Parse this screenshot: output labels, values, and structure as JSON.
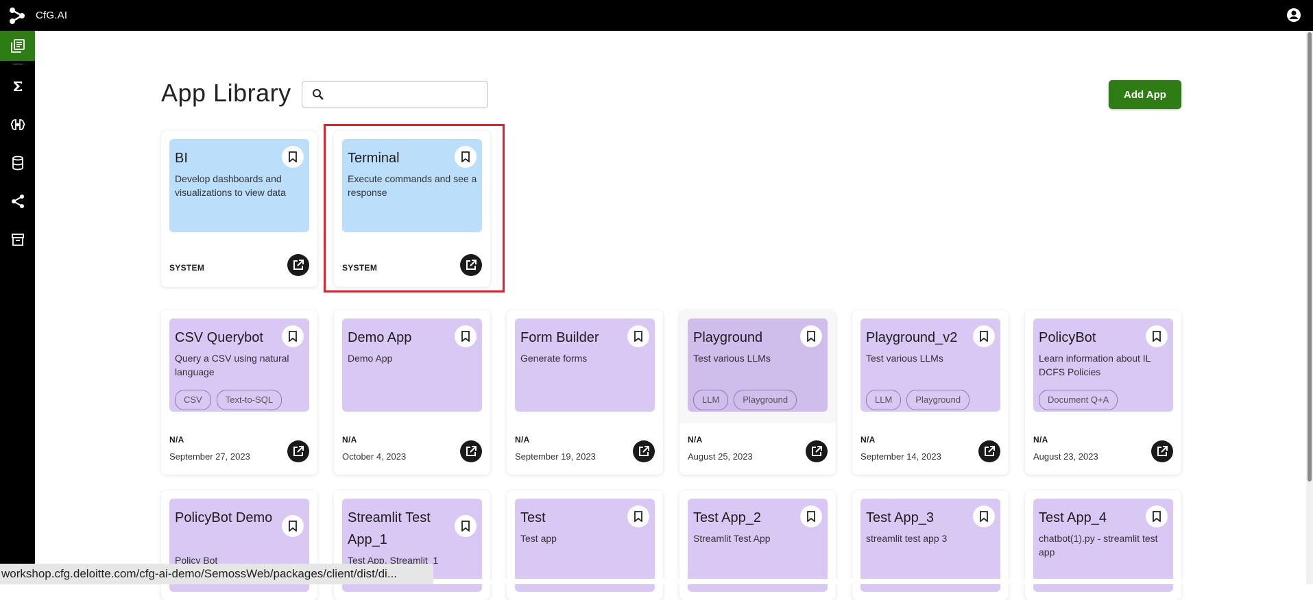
{
  "app": {
    "brand": "CfG.AI"
  },
  "page": {
    "title": "App Library",
    "search_placeholder": "",
    "add_button": "Add App"
  },
  "system_apps": [
    {
      "name": "BI",
      "description": "Develop dashboards and visualizations to view data",
      "owner": "SYSTEM"
    },
    {
      "name": "Terminal",
      "description": "Execute commands and see a response",
      "owner": "SYSTEM"
    }
  ],
  "apps_row1": [
    {
      "name": "CSV Querybot",
      "description": "Query a CSV using natural language",
      "tags": [
        "CSV",
        "Text-to-SQL"
      ],
      "owner": "N/A",
      "date": "September 27, 2023"
    },
    {
      "name": "Demo App",
      "description": "Demo App",
      "tags": [],
      "owner": "N/A",
      "date": "October 4, 2023"
    },
    {
      "name": "Form Builder",
      "description": "Generate forms",
      "tags": [],
      "owner": "N/A",
      "date": "September 19, 2023"
    },
    {
      "name": "Playground",
      "description": "Test various LLMs",
      "tags": [
        "LLM",
        "Playground"
      ],
      "owner": "N/A",
      "date": "August 25, 2023"
    },
    {
      "name": "Playground_v2",
      "description": "Test various LLMs",
      "tags": [
        "LLM",
        "Playground"
      ],
      "owner": "N/A",
      "date": "September 14, 2023"
    },
    {
      "name": "PolicyBot",
      "description": "Learn information about IL DCFS Policies",
      "tags": [
        "Document Q+A"
      ],
      "owner": "N/A",
      "date": "August 23, 2023"
    }
  ],
  "apps_row2": [
    {
      "name": "PolicyBot Demo",
      "description": "Policy Bot"
    },
    {
      "name": "Streamlit Test App_1",
      "description": "Test App, Streamlit_1"
    },
    {
      "name": "Test",
      "description": "Test app"
    },
    {
      "name": "Test App_2",
      "description": "Streamlit Test App"
    },
    {
      "name": "Test App_3",
      "description": "streamlit test app 3"
    },
    {
      "name": "Test App_4",
      "description": "chatbot(1).py - streamlit test app"
    }
  ],
  "status_url": "workshop.cfg.deloitte.com/cfg-ai-demo/SemossWeb/packages/client/dist/di...",
  "colors": {
    "accent": "#2e7d14",
    "system_card": "#bbdefb",
    "app_card": "#d8c8f3",
    "highlight": "#e5202b"
  }
}
